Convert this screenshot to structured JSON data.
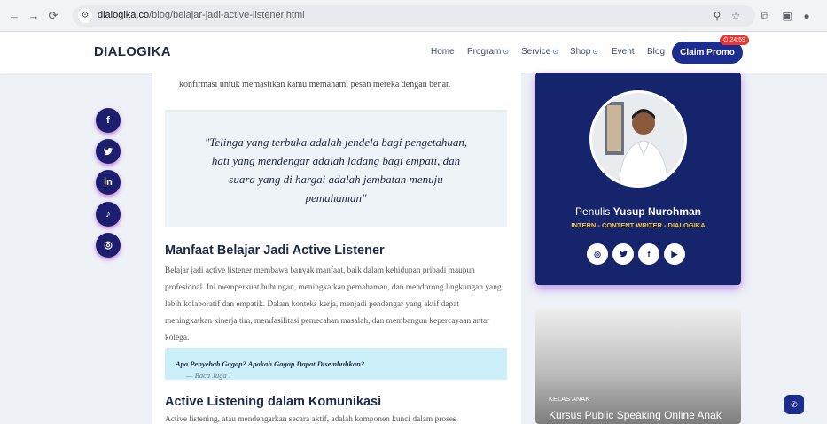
{
  "browser": {
    "url_domain": "dialogika.co",
    "url_path": "/blog/belajar-jadi-active-listener.html"
  },
  "header": {
    "logo": "DIALOGIKA",
    "menu": [
      "Home",
      "Program",
      "Service",
      "Shop",
      "Event",
      "Blog"
    ],
    "cta": "Claim Promo",
    "timer": "24:59"
  },
  "article": {
    "intro": "konfirmasi untuk memastikan kamu memahami pesan mereka dengan benar.",
    "quote": "\"Telinga yang terbuka adalah jendela bagi pengetahuan, hati yang mendengar adalah ladang bagi empati, dan suara yang di hargai adalah jembatan menuju pemahaman\"",
    "h2_benefits": "Manfaat Belajar Jadi Active Listener",
    "p_benefits": "Belajar jadi active listener membawa banyak manfaat, baik dalam kehidupan pribadi maupun profesional. Ini memperkuat hubungan, meningkatkan pemahaman, dan mendorong lingkungan yang lebih kolaboratif dan empatik. Dalam konteks kerja, menjadi pendengar yang aktif dapat meningkatkan kinerja tim, memfasilitasi pemecahan masalah, dan membangun kepercayaan antar kolega.",
    "read_also_prefix": "— Baca Juga :",
    "read_also_link": "Apa Penyebab Gagap? Apakah Gagap Dapat Disembuhkan?",
    "h2_communication": "Active Listening dalam Komunikasi",
    "p_communication": "Active listening, atau mendengarkan secara aktif, adalah komponen kunci dalam proses"
  },
  "share": {
    "icons": [
      "facebook-icon",
      "twitter-icon",
      "linkedin-icon",
      "tiktok-icon",
      "instagram-icon"
    ]
  },
  "author": {
    "prefix": "Penulis",
    "name": "Yusup Nurohman",
    "role": "INTERN - CONTENT WRITER - DIALOGIKA"
  },
  "course": {
    "tag": "KELAS ANAK",
    "title": "Kursus Public Speaking Online Anak"
  },
  "colors": {
    "brand_navy": "#1d2d8f",
    "card_navy": "#16246b",
    "role_gold": "#f5c542",
    "quote_bg": "#eef3f8",
    "read_also_bg": "#cdeffa"
  }
}
